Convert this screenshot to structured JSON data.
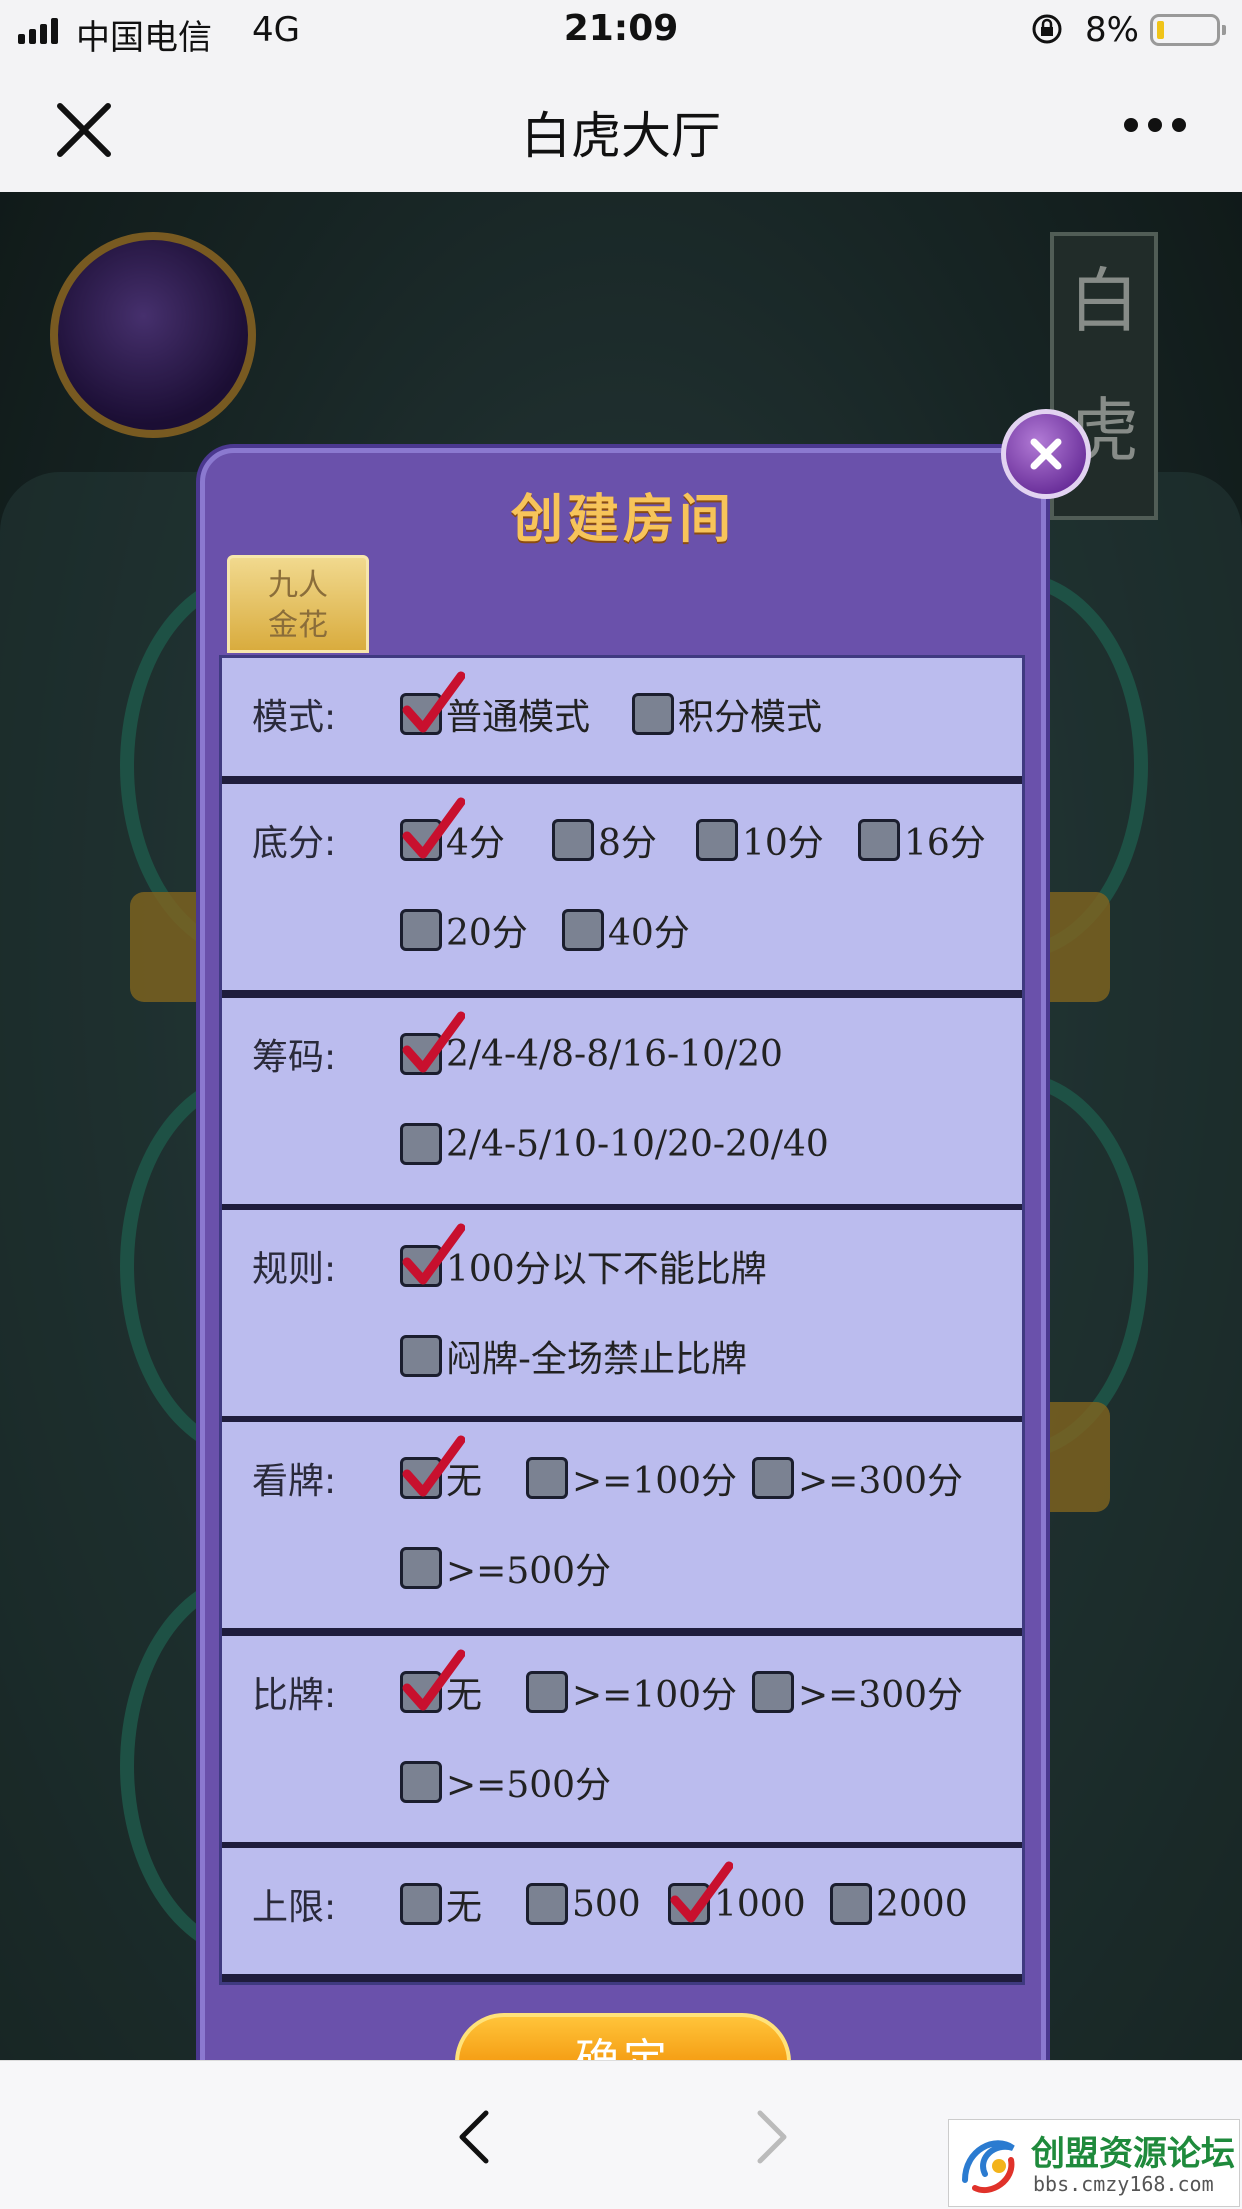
{
  "status_bar": {
    "carrier": "中国电信",
    "network": "4G",
    "time": "21:09",
    "battery": "8%"
  },
  "nav": {
    "title": "白虎大厅",
    "close_icon": "close-icon",
    "more_icon": "more-icon"
  },
  "background": {
    "sign_text": "白虎"
  },
  "dialog": {
    "title": "创建房间",
    "tab": {
      "line1": "九人",
      "line2": "金花"
    },
    "rows": [
      {
        "label": "模式:",
        "options": [
          {
            "text": "普通模式",
            "checked": true
          },
          {
            "text": "积分模式",
            "checked": false
          }
        ]
      },
      {
        "label": "底分:",
        "options": [
          {
            "text": "4分",
            "checked": true
          },
          {
            "text": "8分",
            "checked": false
          },
          {
            "text": "10分",
            "checked": false
          },
          {
            "text": "16分",
            "checked": false
          },
          {
            "text": "20分",
            "checked": false
          },
          {
            "text": "40分",
            "checked": false
          }
        ]
      },
      {
        "label": "筹码:",
        "options": [
          {
            "text": "2/4-4/8-8/16-10/20",
            "checked": true
          },
          {
            "text": "2/4-5/10-10/20-20/40",
            "checked": false
          }
        ]
      },
      {
        "label": "规则:",
        "options": [
          {
            "text": "100分以下不能比牌",
            "checked": true
          },
          {
            "text": "闷牌-全场禁止比牌",
            "checked": false
          }
        ]
      },
      {
        "label": "看牌:",
        "options": [
          {
            "text": "无",
            "checked": true
          },
          {
            "text": ">=100分",
            "checked": false
          },
          {
            "text": ">=300分",
            "checked": false
          },
          {
            "text": ">=500分",
            "checked": false
          }
        ]
      },
      {
        "label": "比牌:",
        "options": [
          {
            "text": "无",
            "checked": true
          },
          {
            "text": ">=100分",
            "checked": false
          },
          {
            "text": ">=300分",
            "checked": false
          },
          {
            "text": ">=500分",
            "checked": false
          }
        ]
      },
      {
        "label": "上限:",
        "options": [
          {
            "text": "无",
            "checked": false
          },
          {
            "text": "500",
            "checked": false
          },
          {
            "text": "1000",
            "checked": true
          },
          {
            "text": "2000",
            "checked": false
          }
        ]
      }
    ],
    "confirm_label": "确定"
  },
  "watermark": {
    "name": "创盟资源论坛",
    "url": "bbs.cmzy168.com"
  }
}
